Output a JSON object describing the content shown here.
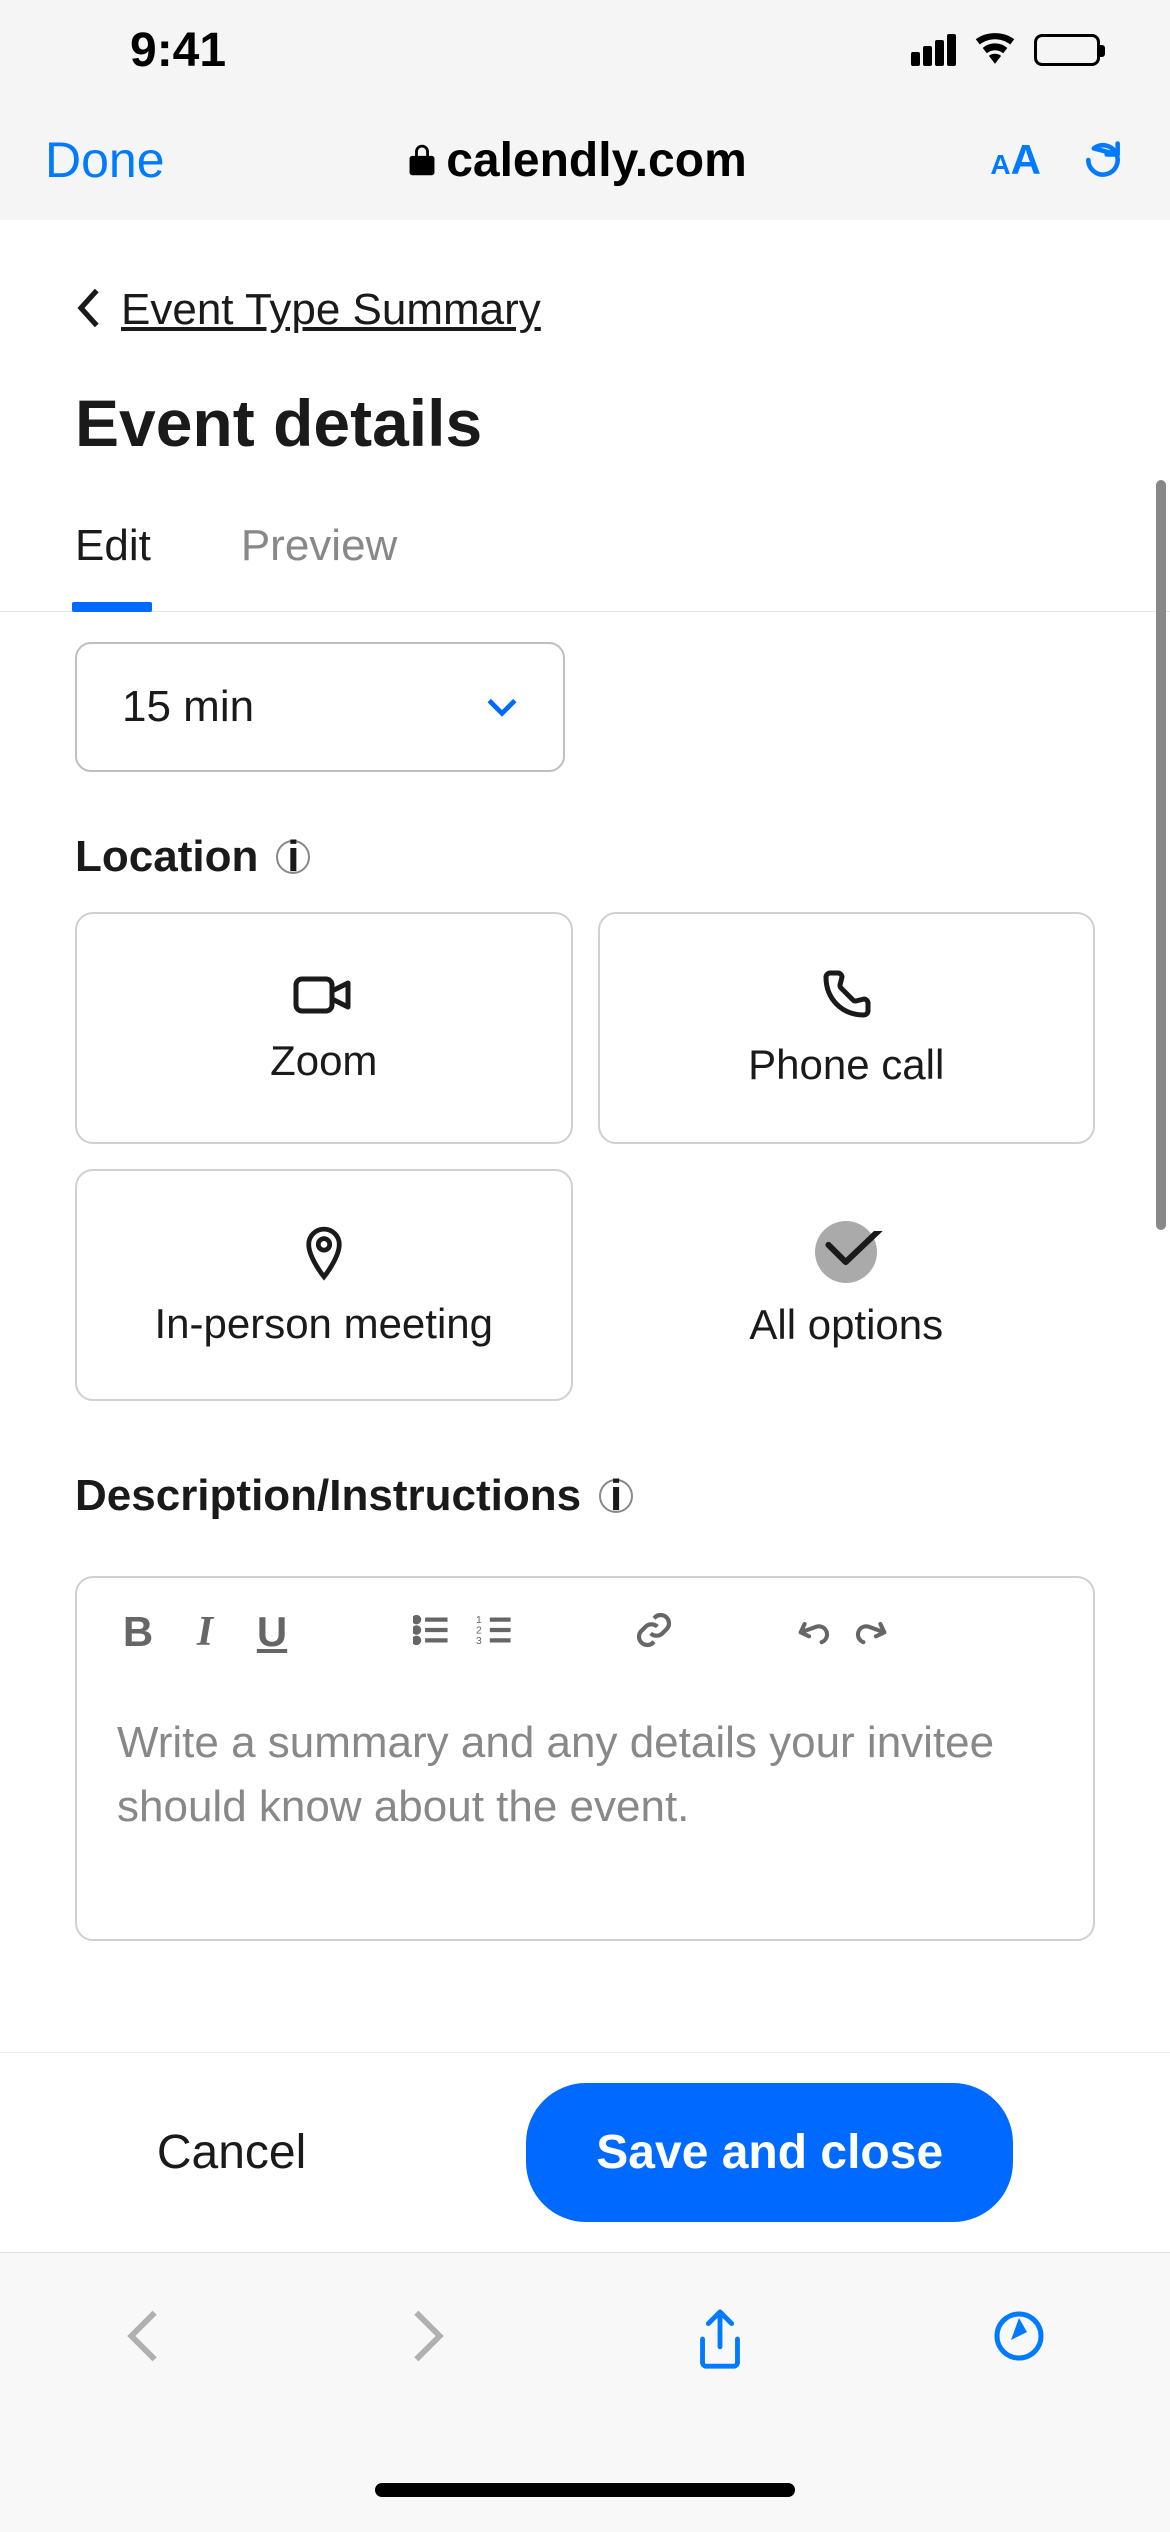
{
  "status": {
    "time": "9:41"
  },
  "browser": {
    "done": "Done",
    "url": "calendly.com",
    "text_size": "A"
  },
  "breadcrumb": {
    "label": "Event Type Summary"
  },
  "page": {
    "title": "Event details"
  },
  "tabs": {
    "edit": "Edit",
    "preview": "Preview"
  },
  "duration": {
    "value": "15 min"
  },
  "location": {
    "label": "Location",
    "options": {
      "zoom": "Zoom",
      "phone": "Phone call",
      "inperson": "In-person meeting",
      "all": "All options"
    }
  },
  "description": {
    "label": "Description/Instructions",
    "placeholder": "Write a summary and any details your invitee should know about the event.",
    "toolbar": {
      "bold": "B",
      "italic": "I",
      "underline": "U"
    }
  },
  "footer": {
    "cancel": "Cancel",
    "save": "Save and close"
  }
}
